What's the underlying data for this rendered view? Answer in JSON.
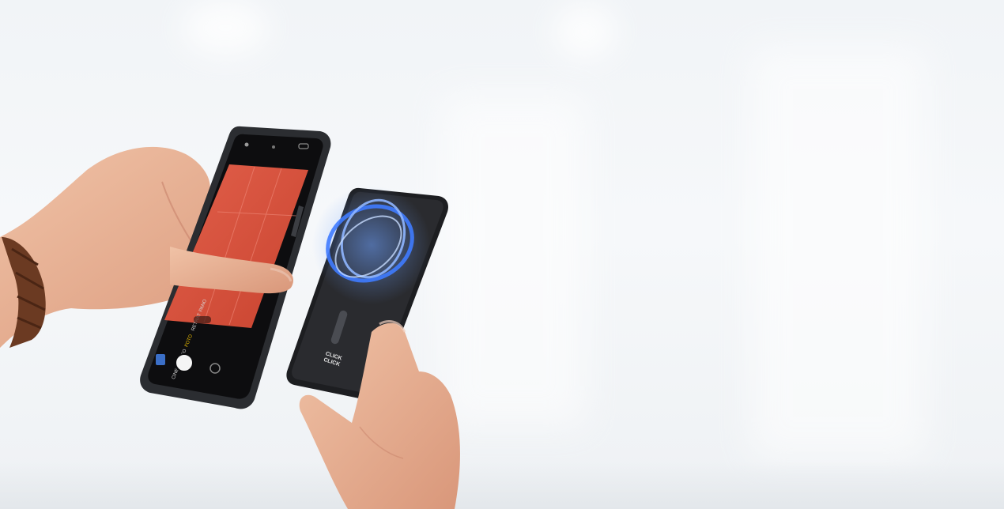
{
  "photo": {
    "description_tags": [
      "hand-holding-phone",
      "hand-holding-power-bank",
      "magnetic-ring-glow"
    ],
    "colors": {
      "background": "#f3f6f9",
      "skin": "#e8b497",
      "skin_shadow": "#c9876a",
      "phone_body": "#2b2d31",
      "phone_screen": "#d9533f",
      "powerbank_body": "#1d1e21",
      "glow_ring": "#3f7bff",
      "watch_strap": "#6b3a22"
    }
  },
  "camera_app": {
    "modes": [
      "CINE",
      "VIDEO",
      "FOTO",
      "RETRAT",
      "PANO"
    ],
    "selected_mode": "FOTO"
  },
  "power_bank": {
    "brand_line_1": "CLICK",
    "brand_line_2": "CLICK"
  }
}
